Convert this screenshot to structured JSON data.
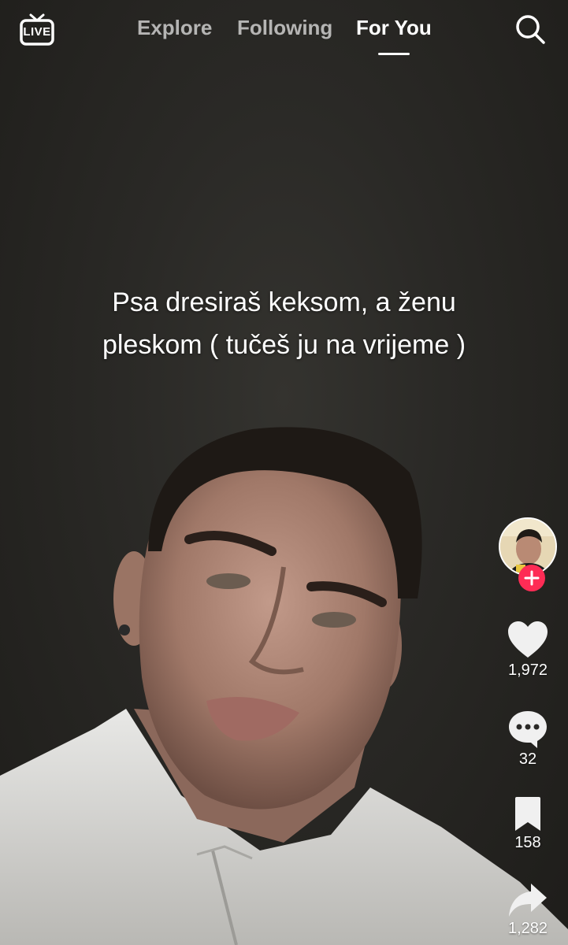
{
  "top_nav": {
    "live_label": "LIVE",
    "tabs": [
      {
        "label": "Explore",
        "active": false
      },
      {
        "label": "Following",
        "active": false
      },
      {
        "label": "For You",
        "active": true
      }
    ],
    "search_icon": "search-icon"
  },
  "caption": {
    "line1": "Psa dresiraš keksom, a ženu",
    "line2": "pleskom ( tučeš ju na vrijeme )"
  },
  "actions": {
    "follow_icon": "plus-icon",
    "likes": "1,972",
    "comments": "32",
    "bookmarks": "158",
    "shares": "1,282"
  },
  "colors": {
    "accent": "#fe2c55",
    "text": "#ffffff",
    "background": "#2a2926"
  }
}
